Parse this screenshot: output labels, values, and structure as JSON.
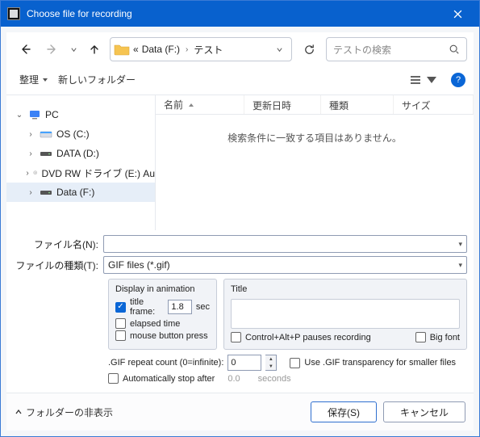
{
  "title": "Choose file for recording",
  "breadcrumb": {
    "seg0": "«",
    "seg1": "Data (F:)",
    "seg2": "テスト"
  },
  "search": {
    "placeholder": "テストの検索"
  },
  "toolbar": {
    "organize": "整理",
    "newfolder": "新しいフォルダー"
  },
  "columns": {
    "name": "名前",
    "date": "更新日時",
    "type": "種類",
    "size": "サイズ"
  },
  "emptymsg": "検索条件に一致する項目はありません。",
  "tree": {
    "pc": "PC",
    "os": "OS (C:)",
    "data": "DATA (D:)",
    "dvd": "DVD RW ドライブ (E:) Au",
    "dataf": "Data (F:)"
  },
  "form": {
    "filename_lbl": "ファイル名(N):",
    "filetype_lbl": "ファイルの種類(T):",
    "filetype_val": "GIF files (*.gif)"
  },
  "display": {
    "legend": "Display in animation",
    "titleframe": "title frame:",
    "titleframe_val": "1.8",
    "sec": "sec",
    "elapsed": "elapsed time",
    "mouse": "mouse button press"
  },
  "titlegrp": {
    "legend": "Title",
    "ctrl": "Control+Alt+P pauses recording",
    "bigfont": "Big font"
  },
  "repeat": {
    "label": ".GIF repeat count (0=infinite):",
    "val": "0",
    "trans": "Use .GIF transparency for smaller files"
  },
  "autostop": {
    "label": "Automatically stop after",
    "val": "0.0",
    "unit": "seconds"
  },
  "buttons": {
    "fold": "フォルダーの非表示",
    "save": "保存(S)",
    "cancel": "キャンセル"
  }
}
